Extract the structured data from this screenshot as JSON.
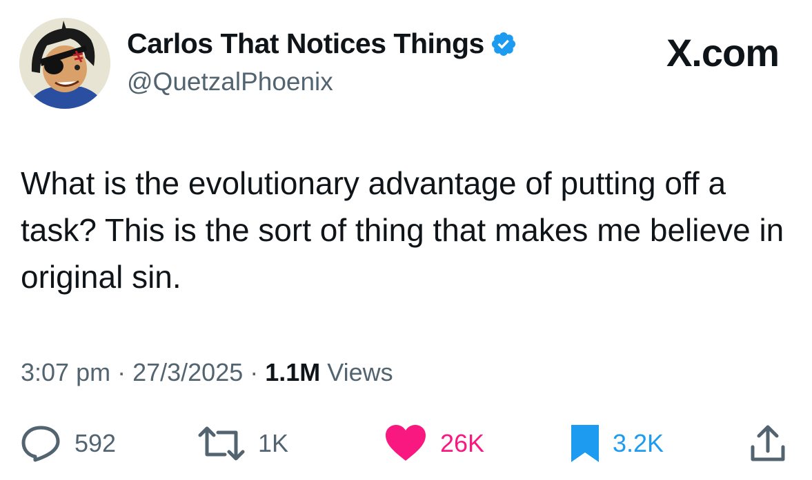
{
  "author": {
    "display_name": "Carlos That Notices Things",
    "handle": "@QuetzalPhoenix",
    "avatar_icon": "avatar-cartoon-eyepatch",
    "verified_color": "#1d9bf0"
  },
  "brand": {
    "label": "X.com"
  },
  "tweet": {
    "text": "What is the evolutionary advantage of putting off a task? This is the sort of thing that makes me believe in original sin."
  },
  "meta": {
    "time": "3:07 pm",
    "separator": " · ",
    "date": "27/3/2025",
    "views_count": "1.1M",
    "views_label": "Views"
  },
  "actions": {
    "replies": {
      "icon": "reply-icon",
      "count": "592"
    },
    "reposts": {
      "icon": "repost-icon",
      "count": "1K"
    },
    "likes": {
      "icon": "heart-icon",
      "count": "26K",
      "color": "#f91880"
    },
    "bookmarks": {
      "icon": "bookmark-icon",
      "count": "3.2K",
      "color": "#1d9bf0"
    },
    "share": {
      "icon": "share-icon"
    }
  }
}
